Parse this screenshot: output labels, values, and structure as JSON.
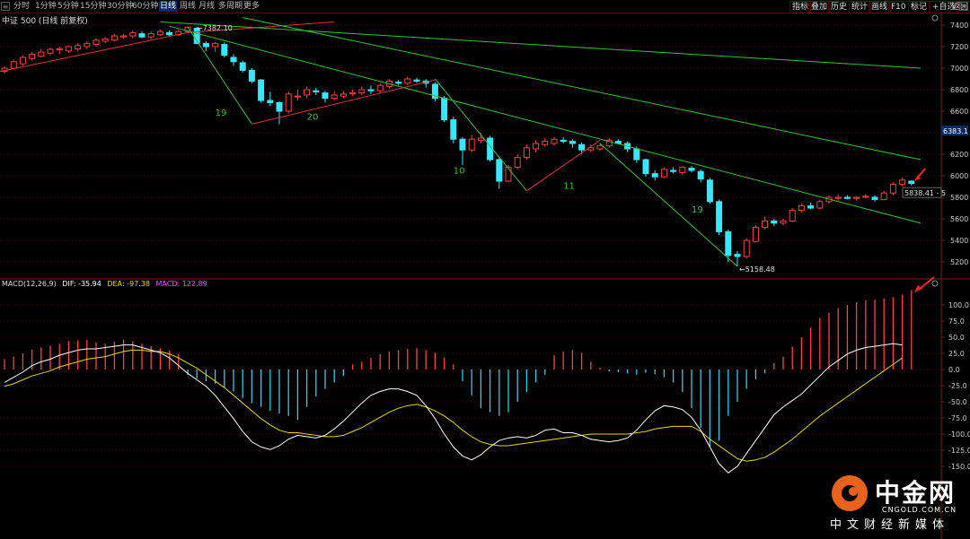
{
  "toolbar": {
    "periods": [
      "分时",
      "1分钟",
      "5分钟",
      "15分钟",
      "30分钟",
      "60分钟",
      "日线",
      "周线",
      "月线",
      "多周期",
      "更多"
    ],
    "active_period": "日线",
    "right_buttons": [
      "指标",
      "叠加",
      "历史",
      "统计",
      "画线",
      "F10",
      "标记",
      "+自选",
      "返回"
    ]
  },
  "price_panel": {
    "title": "中证 500 (日线 前复权)",
    "high_label": "7382.10",
    "low_label": "5158.48",
    "current_label": "5838.41",
    "current_suffix": "- 5",
    "right_tag": "6383.1",
    "wave_labels": [
      "19",
      "20",
      "10",
      "11",
      "19"
    ],
    "colors": {
      "up": "#ff3c3c",
      "down": "#35e8ff",
      "support": "#e03030",
      "resistance": "#35c035",
      "axis": "#7a1a1a"
    }
  },
  "macd_panel": {
    "title": "MACD(12,26,9)",
    "dif_label": "DIF: -35.94",
    "dea_label": "DEA: -97.38",
    "macd_label": "MACD: 122.89",
    "colors": {
      "dif": "#ffffff",
      "dea": "#e8d800",
      "macd": "#ff40ff",
      "pos": "#ff4040",
      "neg": "#35c9e6"
    }
  },
  "watermark": {
    "brand": "中金网",
    "url": "CNGOLD.COM.CN",
    "tagline": "中文财经新媒体"
  },
  "chart_data": [
    {
      "type": "candlestick",
      "title": "中证 500 (日线 前复权)",
      "ylim": [
        5100,
        7480
      ],
      "y_ticks": [
        7400,
        7200,
        7000,
        6800,
        6600,
        6400,
        6200,
        6000,
        5800,
        5600,
        5400,
        5200
      ],
      "candles": [
        [
          6970,
          7000,
          6950,
          7020
        ],
        [
          7000,
          7060,
          6990,
          7080
        ],
        [
          7040,
          7100,
          7020,
          7120
        ],
        [
          7090,
          7130,
          7070,
          7150
        ],
        [
          7110,
          7150,
          7100,
          7180
        ],
        [
          7140,
          7175,
          7120,
          7190
        ],
        [
          7170,
          7180,
          7130,
          7200
        ],
        [
          7160,
          7200,
          7140,
          7210
        ],
        [
          7180,
          7210,
          7160,
          7230
        ],
        [
          7200,
          7230,
          7180,
          7250
        ],
        [
          7220,
          7260,
          7200,
          7280
        ],
        [
          7250,
          7270,
          7230,
          7290
        ],
        [
          7260,
          7300,
          7250,
          7320
        ],
        [
          7290,
          7300,
          7270,
          7320
        ],
        [
          7300,
          7330,
          7280,
          7350
        ],
        [
          7320,
          7290,
          7280,
          7340
        ],
        [
          7290,
          7320,
          7270,
          7340
        ],
        [
          7310,
          7340,
          7300,
          7360
        ],
        [
          7330,
          7310,
          7300,
          7350
        ],
        [
          7310,
          7340,
          7300,
          7360
        ],
        [
          7340,
          7382,
          7330,
          7382
        ],
        [
          7370,
          7230,
          7220,
          7380
        ],
        [
          7230,
          7200,
          7160,
          7250
        ],
        [
          7200,
          7230,
          7150,
          7240
        ],
        [
          7220,
          7120,
          7100,
          7240
        ],
        [
          7100,
          7060,
          7020,
          7130
        ],
        [
          7050,
          6980,
          6960,
          7070
        ],
        [
          6980,
          6880,
          6860,
          7000
        ],
        [
          6890,
          6700,
          6680,
          6900
        ],
        [
          6700,
          6680,
          6650,
          6780
        ],
        [
          6680,
          6600,
          6480,
          6690
        ],
        [
          6600,
          6760,
          6580,
          6780
        ],
        [
          6740,
          6740,
          6700,
          6800
        ],
        [
          6750,
          6800,
          6720,
          6830
        ],
        [
          6790,
          6780,
          6750,
          6820
        ],
        [
          6770,
          6720,
          6680,
          6790
        ],
        [
          6720,
          6750,
          6700,
          6780
        ],
        [
          6740,
          6760,
          6720,
          6790
        ],
        [
          6760,
          6770,
          6740,
          6800
        ],
        [
          6770,
          6800,
          6750,
          6830
        ],
        [
          6800,
          6790,
          6760,
          6840
        ],
        [
          6790,
          6840,
          6770,
          6860
        ],
        [
          6830,
          6880,
          6810,
          6900
        ],
        [
          6870,
          6860,
          6840,
          6890
        ],
        [
          6860,
          6900,
          6840,
          6920
        ],
        [
          6890,
          6880,
          6860,
          6910
        ],
        [
          6880,
          6860,
          6820,
          6900
        ],
        [
          6850,
          6720,
          6690,
          6870
        ],
        [
          6720,
          6520,
          6500,
          6740
        ],
        [
          6520,
          6340,
          6300,
          6550
        ],
        [
          6340,
          6240,
          6100,
          6360
        ],
        [
          6240,
          6340,
          6220,
          6380
        ],
        [
          6330,
          6350,
          6300,
          6400
        ],
        [
          6350,
          6150,
          6130,
          6370
        ],
        [
          6150,
          5950,
          5880,
          6170
        ],
        [
          5950,
          6080,
          5940,
          6100
        ],
        [
          6080,
          6170,
          6060,
          6200
        ],
        [
          6170,
          6260,
          6150,
          6290
        ],
        [
          6250,
          6300,
          6220,
          6330
        ],
        [
          6290,
          6320,
          6270,
          6350
        ],
        [
          6300,
          6340,
          6280,
          6360
        ],
        [
          6330,
          6320,
          6300,
          6360
        ],
        [
          6320,
          6300,
          6260,
          6340
        ],
        [
          6290,
          6240,
          6200,
          6310
        ],
        [
          6240,
          6260,
          6220,
          6290
        ],
        [
          6250,
          6280,
          6230,
          6300
        ],
        [
          6280,
          6330,
          6260,
          6350
        ],
        [
          6320,
          6300,
          6290,
          6340
        ],
        [
          6300,
          6250,
          6220,
          6320
        ],
        [
          6250,
          6150,
          6120,
          6270
        ],
        [
          6150,
          6020,
          5990,
          6160
        ],
        [
          6020,
          5990,
          5960,
          6050
        ],
        [
          5990,
          6060,
          5980,
          6080
        ],
        [
          6050,
          6040,
          6020,
          6080
        ],
        [
          6030,
          6080,
          6010,
          6090
        ],
        [
          6070,
          6050,
          6030,
          6090
        ],
        [
          6040,
          5970,
          5940,
          6060
        ],
        [
          5960,
          5760,
          5740,
          5980
        ],
        [
          5760,
          5480,
          5450,
          5780
        ],
        [
          5480,
          5260,
          5200,
          5500
        ],
        [
          5270,
          5250,
          5158,
          5300
        ],
        [
          5250,
          5400,
          5230,
          5420
        ],
        [
          5390,
          5520,
          5380,
          5540
        ],
        [
          5520,
          5580,
          5500,
          5620
        ],
        [
          5580,
          5560,
          5530,
          5600
        ],
        [
          5560,
          5580,
          5540,
          5600
        ],
        [
          5580,
          5680,
          5570,
          5700
        ],
        [
          5680,
          5720,
          5660,
          5740
        ],
        [
          5720,
          5700,
          5690,
          5750
        ],
        [
          5700,
          5760,
          5690,
          5780
        ],
        [
          5760,
          5800,
          5740,
          5820
        ],
        [
          5790,
          5800,
          5770,
          5830
        ],
        [
          5800,
          5790,
          5780,
          5820
        ],
        [
          5790,
          5800,
          5770,
          5810
        ],
        [
          5800,
          5810,
          5790,
          5830
        ],
        [
          5800,
          5780,
          5760,
          5820
        ],
        [
          5780,
          5840,
          5770,
          5860
        ],
        [
          5840,
          5920,
          5820,
          5940
        ],
        [
          5920,
          5960,
          5900,
          5980
        ],
        [
          5950,
          5930,
          5910,
          5960
        ]
      ],
      "annotations": [
        {
          "text": "7382.10",
          "x": 20,
          "y": 7382
        },
        {
          "text": "5158.48",
          "x": 80,
          "y": 5158
        },
        {
          "text": "5838.41",
          "x": 98,
          "y": 5840
        }
      ],
      "wave_labels": [
        {
          "text": "19",
          "x": 23,
          "y": 6560
        },
        {
          "text": "20",
          "x": 33,
          "y": 6520
        },
        {
          "text": "10",
          "x": 49,
          "y": 6020
        },
        {
          "text": "11",
          "x": 61,
          "y": 5880
        },
        {
          "text": "19",
          "x": 75,
          "y": 5660
        }
      ],
      "trendlines": [
        {
          "color": "red",
          "points": [
            [
              -1,
              6960
            ],
            [
              20,
              7330
            ],
            [
              36,
              7430
            ]
          ]
        },
        {
          "color": "green",
          "points": [
            [
              17,
              7430
            ],
            [
              100,
              7000
            ]
          ]
        },
        {
          "color": "green",
          "points": [
            [
              26,
              7470
            ],
            [
              100,
              6150
            ]
          ]
        },
        {
          "color": "green",
          "points": [
            [
              18,
              7390
            ],
            [
              100,
              5560
            ]
          ]
        },
        {
          "color": "green",
          "points": [
            [
              20,
              7382
            ],
            [
              27,
              6480
            ]
          ]
        },
        {
          "color": "green",
          "points": [
            [
              47,
              6900
            ],
            [
              57,
              5860
            ]
          ]
        },
        {
          "color": "green",
          "points": [
            [
              65,
              6300
            ],
            [
              80,
              5158
            ]
          ]
        },
        {
          "color": "red",
          "points": [
            [
              27,
              6480
            ],
            [
              47,
              6890
            ]
          ]
        },
        {
          "color": "red",
          "points": [
            [
              57,
              5860
            ],
            [
              65,
              6330
            ]
          ]
        }
      ]
    },
    {
      "type": "macd",
      "title": "MACD(12,26,9)",
      "ylim": [
        -160,
        125
      ],
      "y_ticks": [
        100,
        75,
        50,
        25,
        0,
        -25,
        -50,
        -75,
        -100,
        -125,
        -150
      ],
      "hist": [
        16,
        20,
        25,
        31,
        34,
        37,
        40,
        44,
        45,
        46,
        42,
        40,
        43,
        46,
        44,
        40,
        36,
        33,
        29,
        24,
        -8,
        -14,
        -18,
        -22,
        -28,
        -34,
        -44,
        -52,
        -58,
        -64,
        -68,
        -72,
        -78,
        -58,
        -42,
        -30,
        -20,
        -10,
        8,
        12,
        18,
        24,
        28,
        30,
        32,
        33,
        30,
        26,
        18,
        8,
        -18,
        -40,
        -60,
        -66,
        -72,
        -66,
        -50,
        -35,
        -20,
        -8,
        22,
        28,
        30,
        26,
        12,
        3,
        -3,
        -4,
        -6,
        -8,
        -5,
        -7,
        -12,
        -20,
        -35,
        -60,
        -90,
        -120,
        -110,
        -72,
        -50,
        -30,
        -15,
        -6,
        10,
        20,
        35,
        50,
        65,
        80,
        88,
        95,
        100,
        104,
        107,
        108,
        110,
        112,
        116,
        122.89
      ],
      "dif": [
        -20,
        -12,
        -4,
        6,
        12,
        16,
        22,
        26,
        30,
        32,
        32,
        34,
        36,
        38,
        38,
        34,
        30,
        26,
        18,
        6,
        -6,
        -16,
        -26,
        -40,
        -58,
        -76,
        -96,
        -112,
        -120,
        -124,
        -118,
        -108,
        -102,
        -104,
        -106,
        -102,
        -92,
        -80,
        -66,
        -52,
        -40,
        -34,
        -30,
        -30,
        -34,
        -40,
        -56,
        -76,
        -100,
        -120,
        -134,
        -140,
        -132,
        -120,
        -110,
        -106,
        -104,
        -106,
        -102,
        -94,
        -92,
        -98,
        -98,
        -102,
        -108,
        -110,
        -112,
        -110,
        -106,
        -94,
        -78,
        -64,
        -56,
        -58,
        -62,
        -74,
        -94,
        -120,
        -146,
        -160,
        -150,
        -130,
        -110,
        -90,
        -70,
        -58,
        -48,
        -38,
        -24,
        -10,
        4,
        14,
        24,
        30,
        34,
        36,
        38,
        40,
        38,
        -35.94
      ],
      "dea": [
        -26,
        -22,
        -16,
        -10,
        -6,
        -2,
        4,
        8,
        12,
        16,
        18,
        20,
        24,
        28,
        30,
        30,
        28,
        28,
        24,
        18,
        10,
        2,
        -8,
        -18,
        -28,
        -40,
        -52,
        -64,
        -76,
        -86,
        -94,
        -98,
        -98,
        -100,
        -102,
        -104,
        -104,
        -102,
        -96,
        -90,
        -82,
        -74,
        -66,
        -60,
        -56,
        -54,
        -58,
        -64,
        -72,
        -82,
        -94,
        -104,
        -112,
        -116,
        -118,
        -118,
        -116,
        -114,
        -112,
        -110,
        -108,
        -106,
        -104,
        -102,
        -100,
        -100,
        -100,
        -100,
        -100,
        -98,
        -96,
        -92,
        -90,
        -88,
        -88,
        -88,
        -96,
        -108,
        -118,
        -128,
        -138,
        -142,
        -140,
        -136,
        -128,
        -118,
        -108,
        -96,
        -84,
        -72,
        -62,
        -52,
        -42,
        -32,
        -22,
        -12,
        -2,
        8,
        18,
        -97.38
      ]
    }
  ]
}
